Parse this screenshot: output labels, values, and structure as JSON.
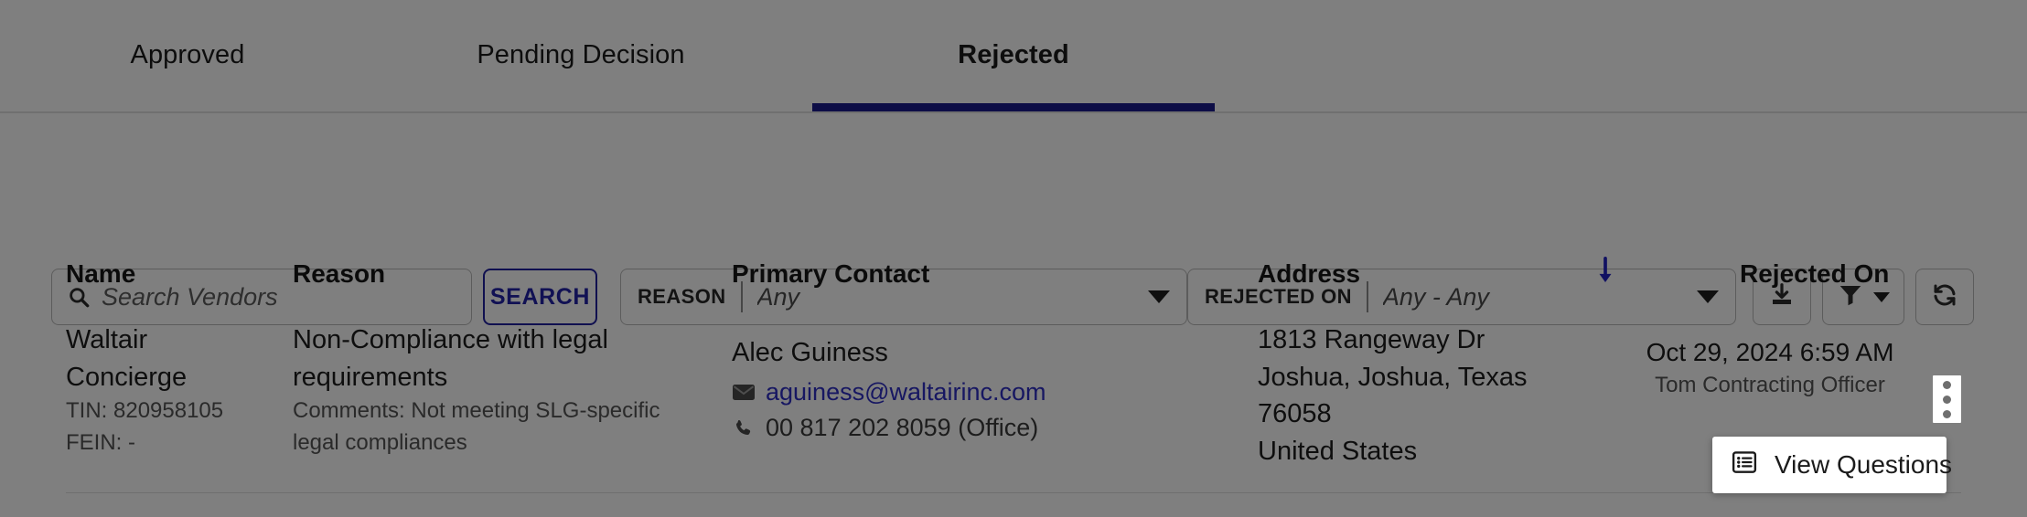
{
  "tabs": [
    {
      "label": "Approved",
      "active": false
    },
    {
      "label": "Pending Decision",
      "active": false
    },
    {
      "label": "Rejected",
      "active": true
    }
  ],
  "filters": {
    "search": {
      "value": "",
      "placeholder": "Search Vendors",
      "icon": "search-icon"
    },
    "search_button": "SEARCH",
    "reason": {
      "label": "REASON",
      "value": "Any"
    },
    "rejected_on": {
      "label": "REJECTED ON",
      "value": "Any - Any"
    },
    "actions": [
      {
        "name": "download-icon"
      },
      {
        "name": "filter-icon"
      },
      {
        "name": "refresh-icon"
      }
    ]
  },
  "table": {
    "columns": [
      {
        "key": "name",
        "label": "Name"
      },
      {
        "key": "reason",
        "label": "Reason"
      },
      {
        "key": "contact",
        "label": "Primary Contact"
      },
      {
        "key": "address",
        "label": "Address"
      },
      {
        "key": "rejected_on",
        "label": "Rejected On"
      }
    ],
    "sort": {
      "icon": "arrow-down-icon",
      "direction": "desc",
      "color": "#2222c4"
    },
    "rows": [
      {
        "name": "Waltair Concierge",
        "tin": "TIN: 820958105",
        "fein": "FEIN: -",
        "reason": "Non-Compliance with legal requirements",
        "comments": "Comments: Not meeting SLG-specific legal compliances",
        "contact_name": "Alec Guiness",
        "contact_email": "aguiness@waltairinc.com",
        "contact_phone": "00 817 202 8059 (Office)",
        "address_line1": "1813 Rangeway Dr",
        "address_line2": "Joshua, Joshua, Texas",
        "address_line3": "76058",
        "address_line4": "United States",
        "rejected_on_date": "Oct 29, 2024 6:59 AM",
        "rejected_by": "Tom Contracting Officer"
      }
    ]
  },
  "row_menu": {
    "trigger_icon": "kebab-menu-icon",
    "items": [
      {
        "label": "View Questions",
        "icon": "list-icon"
      }
    ]
  },
  "colors": {
    "accent": "#1a1a8c",
    "link": "#2f2fc4",
    "sort_arrow": "#2222c4",
    "backdrop": "rgba(0,0,0,0.50)"
  }
}
